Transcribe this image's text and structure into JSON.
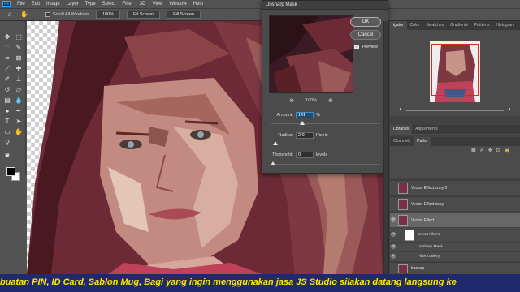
{
  "app": {
    "logo": "Ps"
  },
  "menu": [
    "File",
    "Edit",
    "Image",
    "Layer",
    "Type",
    "Select",
    "Filter",
    "3D",
    "View",
    "Window",
    "Help"
  ],
  "options_bar": {
    "tool_icon": "hand-icon",
    "scroll_all_label": "Scroll All Windows",
    "zoom_value": "100%",
    "fit_screen": "Fit Screen",
    "fill_screen": "Fill Screen"
  },
  "tools": [
    "move-icon",
    "marquee-icon",
    "lasso-icon",
    "quick-select-icon",
    "crop-icon",
    "frame-icon",
    "eyedropper-icon",
    "healing-icon",
    "brush-icon",
    "stamp-icon",
    "history-brush-icon",
    "eraser-icon",
    "gradient-icon",
    "blur-icon",
    "dodge-icon",
    "pen-icon",
    "type-icon",
    "path-select-icon",
    "shape-icon",
    "hand-icon",
    "zoom-icon",
    "more-icon"
  ],
  "dialog": {
    "title": "Unsharp Mask",
    "ok": "OK",
    "cancel": "Cancel",
    "preview_label": "Preview",
    "preview_checked": true,
    "zoom": "100%",
    "amount_label": "Amount:",
    "amount_value": "141",
    "amount_unit": "%",
    "amount_fraction": 0.28,
    "radius_label": "Radius:",
    "radius_value": "2.0",
    "radius_unit": "Pixels",
    "radius_fraction": 0.02,
    "threshold_label": "Threshold:",
    "threshold_value": "0",
    "threshold_unit": "levels",
    "threshold_fraction": 0.0
  },
  "top_panel": {
    "tabs": [
      "igator",
      "Color",
      "Swatches",
      "Gradients",
      "Patterns",
      "Histogram"
    ]
  },
  "mid_panel_1": {
    "tabs": [
      "Libraries",
      "Adjustments"
    ]
  },
  "mid_panel_2": {
    "tabs": [
      "Channels",
      "Paths"
    ]
  },
  "layers": [
    {
      "name": "Vector Effect copy 2"
    },
    {
      "name": "Vector Effect copy"
    },
    {
      "name": "Vector Effect"
    },
    {
      "name": "Smart Filters"
    },
    {
      "name": "Unsharp Mask"
    },
    {
      "name": "Filter Gallery"
    },
    {
      "name": "backup"
    }
  ],
  "ticker": "buatan PIN, ID Card, Sablon Mug,  Bagi yang ingin menggunakan jasa JS Studio silakan datang langsung ke",
  "colors": {
    "accent": "#3d8fd6",
    "ticker_bg": "#1f2a6e",
    "ticker_text": "#ffe600",
    "nav_box": "#e0261f"
  }
}
